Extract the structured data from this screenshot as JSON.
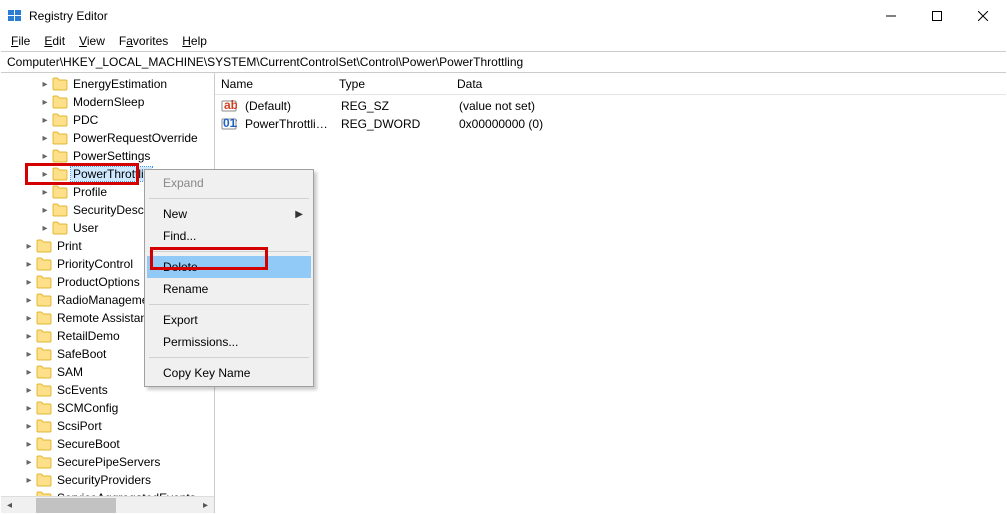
{
  "title": "Registry Editor",
  "menubar": [
    "File",
    "Edit",
    "View",
    "Favorites",
    "Help"
  ],
  "address": "Computer\\HKEY_LOCAL_MACHINE\\SYSTEM\\CurrentControlSet\\Control\\Power\\PowerThrottling",
  "columns": {
    "name": "Name",
    "type": "Type",
    "data": "Data"
  },
  "values_list": [
    {
      "icon": "ab",
      "name": "(Default)",
      "type": "REG_SZ",
      "data": "(value not set)"
    },
    {
      "icon": "dw",
      "name": "PowerThrottling...",
      "type": "REG_DWORD",
      "data": "0x00000000 (0)"
    }
  ],
  "tree_d2": [
    "EnergyEstimation",
    "ModernSleep",
    "PDC",
    "PowerRequestOverride",
    "PowerSettings",
    "PowerThrottlin",
    "Profile",
    "SecurityDescrip",
    "User"
  ],
  "tree_d1": [
    "Print",
    "PriorityControl",
    "ProductOptions",
    "RadioManagemen",
    "Remote Assistanc",
    "RetailDemo",
    "SafeBoot",
    "SAM",
    "ScEvents",
    "SCMConfig",
    "ScsiPort",
    "SecureBoot",
    "SecurePipeServers",
    "SecurityProviders",
    "ServiceAggregatedEvents"
  ],
  "selected": "PowerThrottlin",
  "ctx": {
    "expand": "Expand",
    "new": "New",
    "find": "Find...",
    "delete": "Delete",
    "rename": "Rename",
    "export": "Export",
    "permissions": "Permissions...",
    "copykey": "Copy Key Name"
  }
}
